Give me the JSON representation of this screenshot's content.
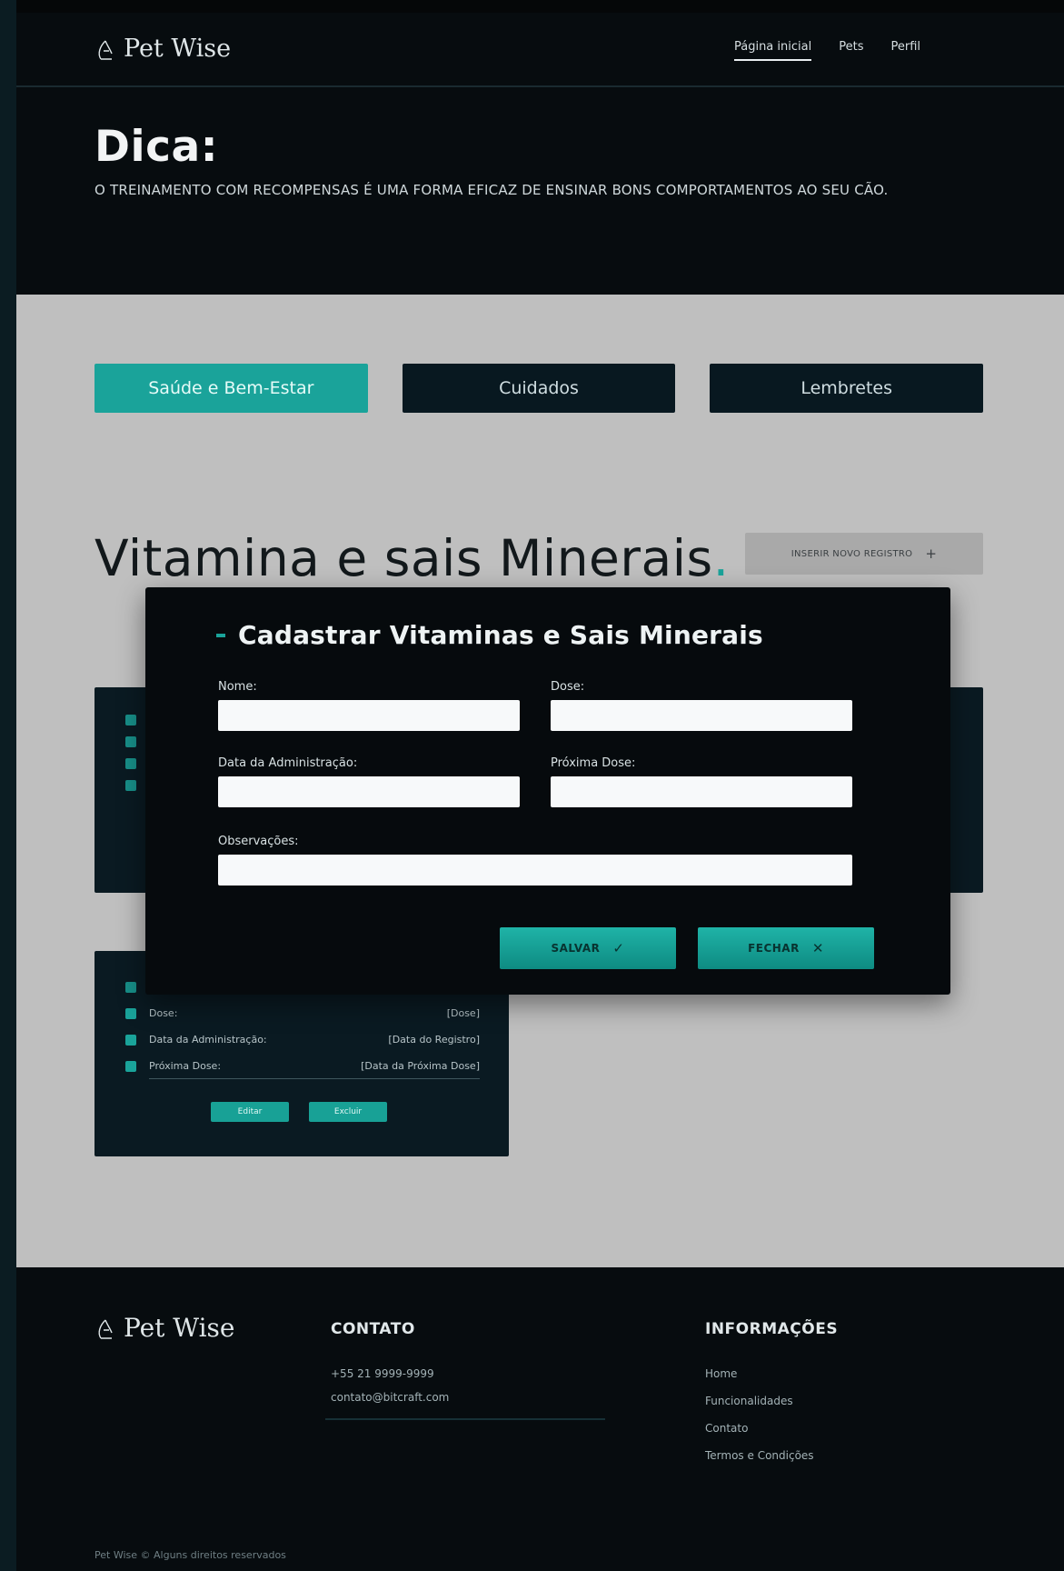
{
  "brand": {
    "name": "Pet Wise"
  },
  "nav": {
    "items": [
      "Página inicial",
      "Pets",
      "Perfil"
    ]
  },
  "tip": {
    "heading": "Dica:",
    "text": "O treinamento com recompensas é uma forma eficaz de ensinar bons comportamentos ao seu cão."
  },
  "tabs": [
    "Saúde e Bem-Estar",
    "Cuidados",
    "Lembretes"
  ],
  "section": {
    "title": "Vitamina e sais Minerais",
    "title_dot": ".",
    "add_button": "INSERIR NOVO REGISTRO",
    "add_icon": "+"
  },
  "card2": {
    "rows": [
      {
        "label": "Dose:",
        "value": "[Dose]"
      },
      {
        "label": "Data da Administração:",
        "value": "[Data do Registro]"
      },
      {
        "label": "Próxima Dose:",
        "value": "[Data da Próxima Dose]"
      }
    ],
    "buttons": [
      "Editar",
      "Excluir"
    ]
  },
  "modal": {
    "title": "Cadastrar Vitaminas e Sais Minerais",
    "fields": {
      "nome": {
        "label": "Nome:",
        "value": ""
      },
      "dose": {
        "label": "Dose:",
        "value": ""
      },
      "data_admin": {
        "label": "Data da Administração:",
        "value": ""
      },
      "proxima_dose": {
        "label": "Próxima Dose:",
        "value": ""
      },
      "observacoes": {
        "label": "Observações:",
        "value": ""
      }
    },
    "save": {
      "label": "SALVAR",
      "icon": "✓"
    },
    "close": {
      "label": "FECHAR",
      "icon": "✕"
    }
  },
  "footer": {
    "contact_heading": "CONTATO",
    "phone": "+55 21 9999-9999",
    "email": "contato@bitcraft.com",
    "info_heading": "INFORMAÇÕES",
    "info_links": [
      "Home",
      "Funcionalidades",
      "Contato",
      "Termos e Condições"
    ],
    "copyright": "Pet Wise © Alguns direitos reservados"
  },
  "colors": {
    "accent": "#1aa39a",
    "dark": "#070c0f",
    "card": "#0a1a22",
    "content_bg": "#bfbfbf"
  }
}
